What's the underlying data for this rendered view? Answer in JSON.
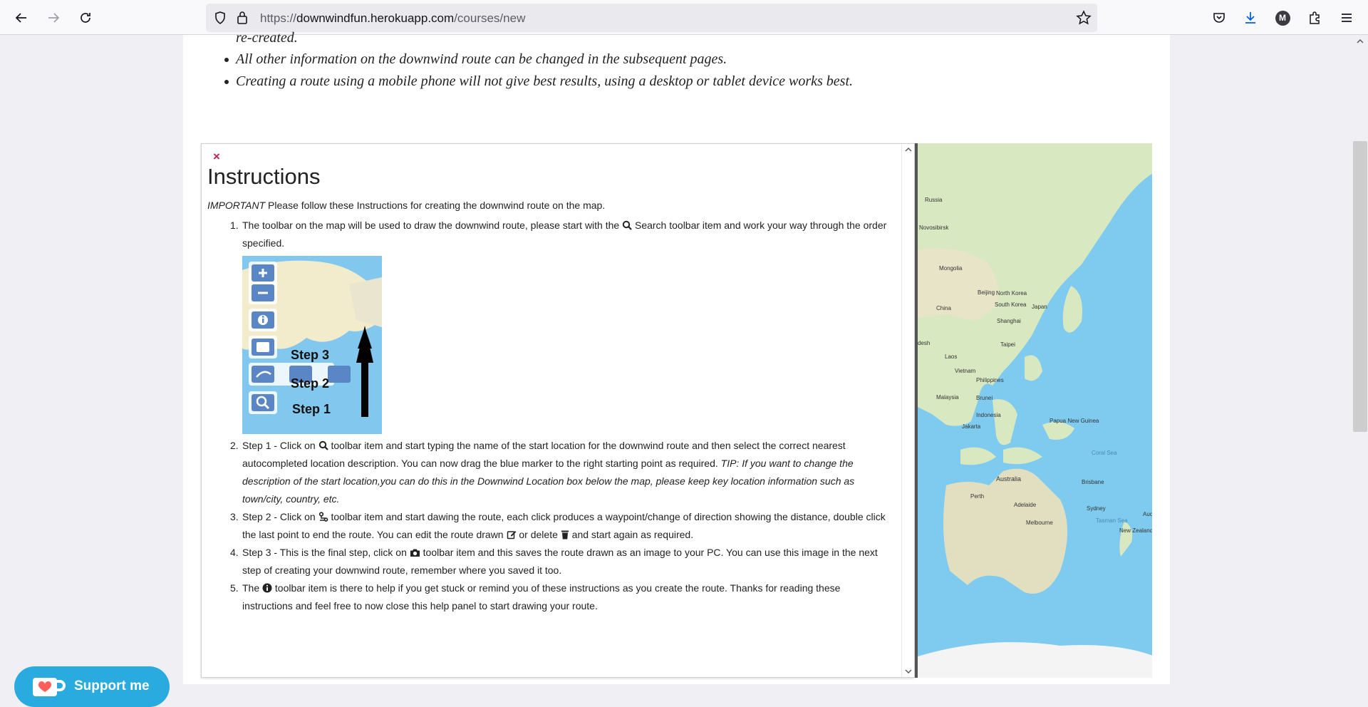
{
  "browser": {
    "url_prefix": "https://",
    "url_host": "downwindfun.herokuapp.com",
    "url_path": "/courses/new",
    "profile_initial": "M"
  },
  "intro_bullets": [
    "re-created.",
    "All other information on the downwind route can be changed in the subsequent pages.",
    "Creating a route using a mobile phone will not give best results, using a desktop or tablet device works best."
  ],
  "instructions": {
    "close": "×",
    "title": "Instructions",
    "important_label": "IMPORTANT",
    "important_text": " Please follow these Instructions for creating the downwind route on the map.",
    "step1_text_a": "The toolbar on the map will be used to draw the downwind route, please start with the ",
    "step1_text_b": " Search toolbar item and work your way through the order specified.",
    "toolbar_image_labels": [
      "Step 3",
      "Step 2",
      "Step 1"
    ],
    "step2_a": "Step 1 - Click on ",
    "step2_b": " toolbar item and start typing the name of the start location for the downwind route and then select the correct nearest autocompleted location description. You can now drag the blue marker to the right starting point as required. ",
    "step2_tip": "TIP: If you want to change the description of the start location,you can do this in the Downwind Location box below the map, please keep key location information such as town/city, country, etc.",
    "step3_a": "Step 2 - Click on ",
    "step3_b": " toolbar item and start dawing the route, each click produces a waypoint/change of direction showing the distance, double click the last point to end the route. You can edit the route drawn ",
    "step3_c": " or delete ",
    "step3_d": " and start again as required.",
    "step4_a": "Step 3 - This is the final step, click on ",
    "step4_b": " toolbar item and this saves the route drawn as an image to your PC. You can use this image in the next step of creating your downwind route, remember where you saved it too.",
    "step5_a": "The ",
    "step5_b": " toolbar item is there to help if you get stuck or remind you of these instructions as you create the route. Thanks for reading these instructions and feel free to now close this help panel to start drawing your route."
  },
  "map_labels": [
    "Russia",
    "Mongolia",
    "China",
    "Beijing",
    "North Korea",
    "South Korea",
    "Japan",
    "Shanghai",
    "Laos",
    "Vietnam",
    "Philippines",
    "Malaysia",
    "Indonesia",
    "Papua New Guinea",
    "Australia",
    "Brisbane",
    "Perth",
    "Adelaide",
    "Sydney",
    "Melbourne",
    "New Zealand",
    "Jakarta",
    "desh",
    "Taipei",
    "Novosibirsk",
    "Brunei",
    "Coral Sea",
    "Tasman Sea",
    "Auckland"
  ],
  "support_button": "Support me",
  "colors": {
    "accent": "#29abe0",
    "close": "#c0224d",
    "ocean": "#7fcbf0"
  }
}
